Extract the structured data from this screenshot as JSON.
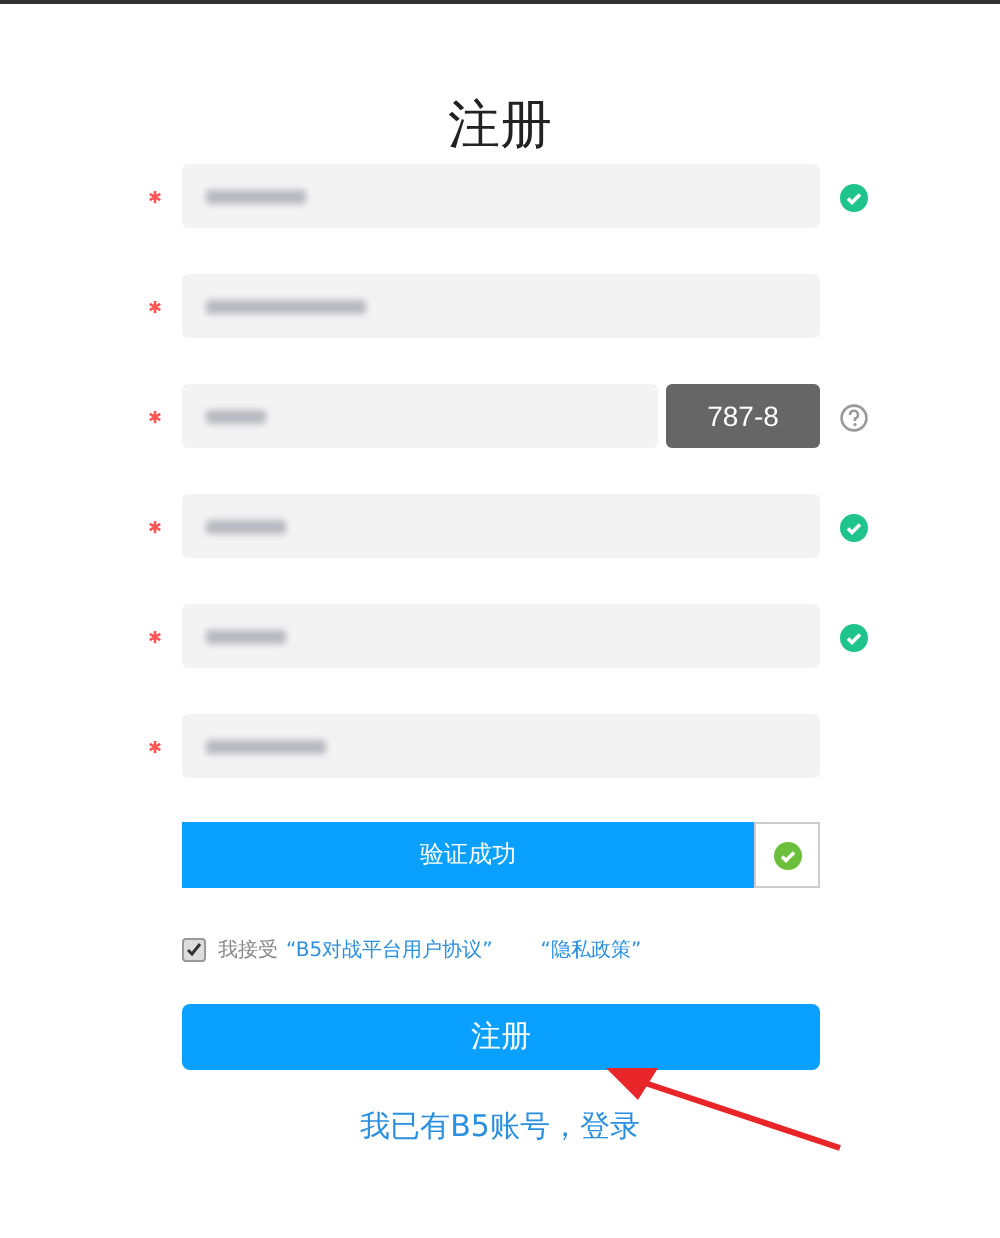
{
  "title": "注册",
  "fields": [
    {
      "kind": "text",
      "required": true,
      "valid": true
    },
    {
      "kind": "text",
      "required": true,
      "valid": false
    },
    {
      "kind": "captcha",
      "required": true,
      "valid": false,
      "help": true,
      "code": "787-8"
    },
    {
      "kind": "text",
      "required": true,
      "valid": true
    },
    {
      "kind": "text",
      "required": true,
      "valid": true
    },
    {
      "kind": "text",
      "required": true,
      "valid": false
    }
  ],
  "verify": {
    "label": "验证成功",
    "verified": true
  },
  "agreement": {
    "checked": true,
    "text": "我接受",
    "links": [
      "“B5对战平台用户协议”",
      "“隐私政策”"
    ]
  },
  "submit": "注册",
  "login_link": "我已有B5账号，登录"
}
